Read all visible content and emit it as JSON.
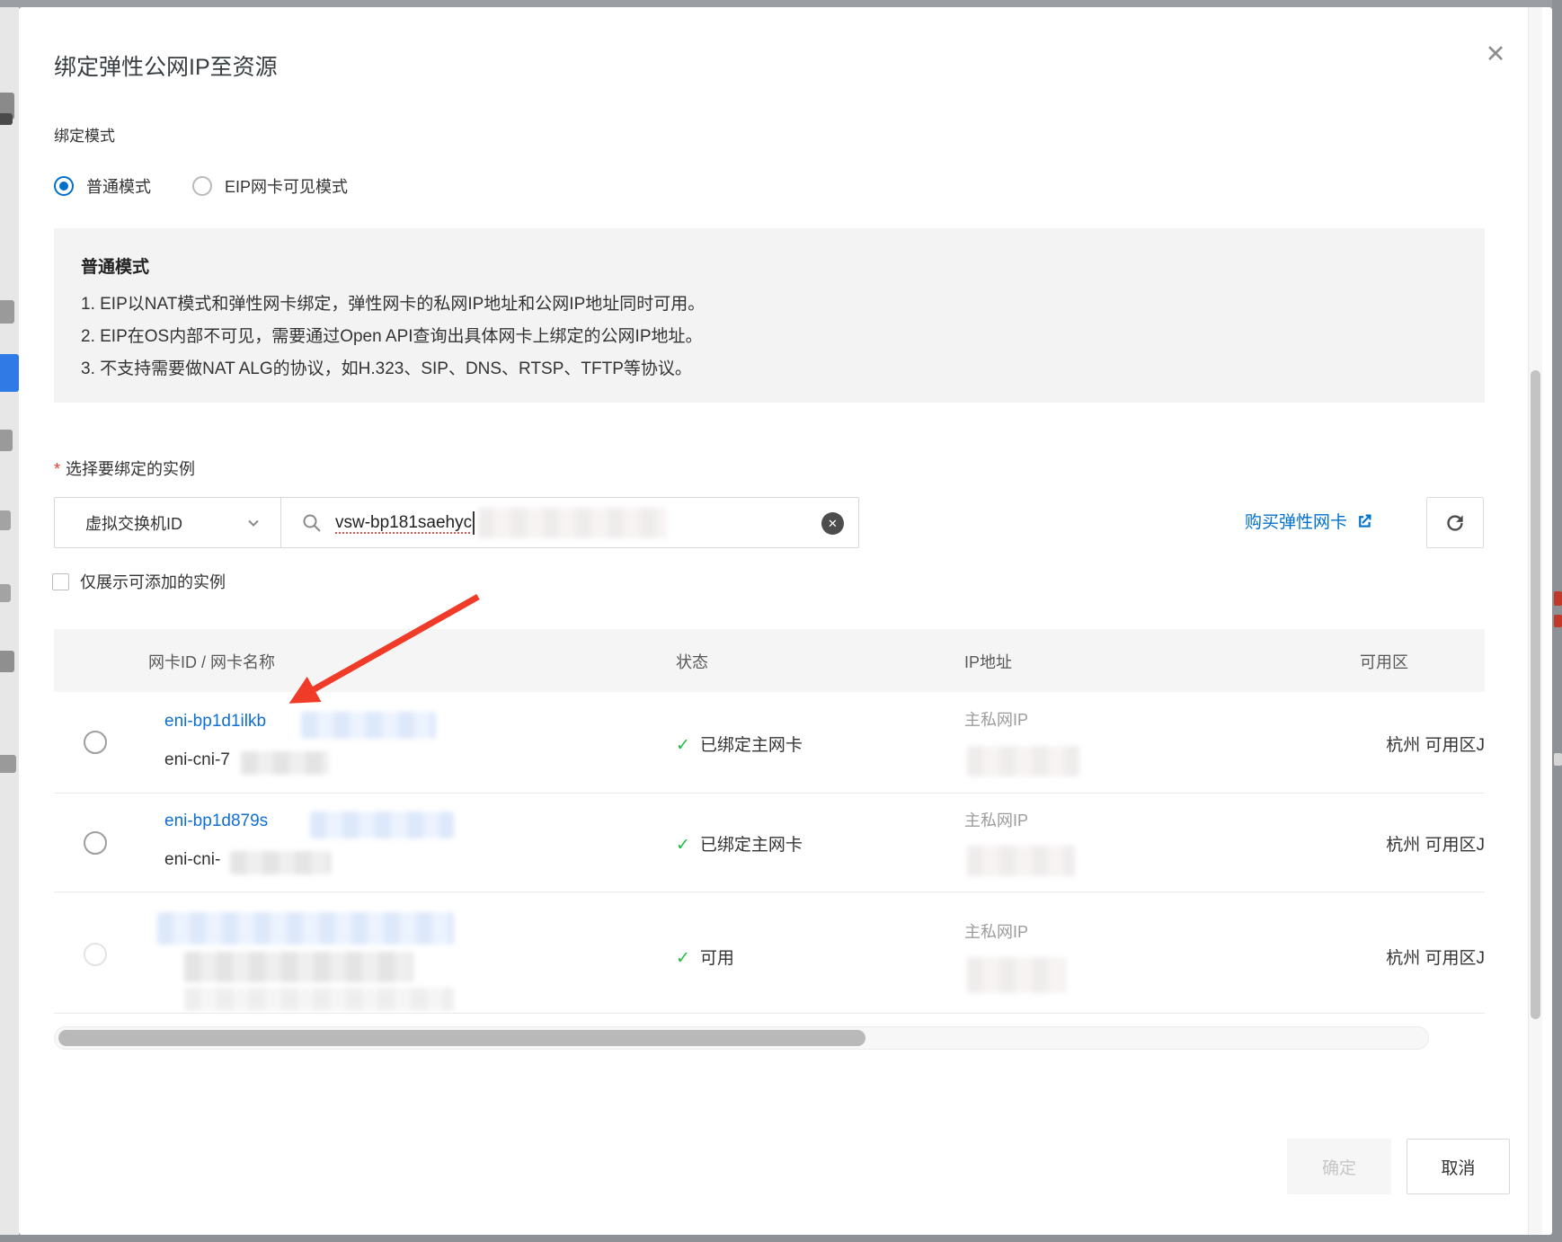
{
  "icons": {
    "close": "✕",
    "check": "✓",
    "clear": "✕"
  },
  "modal": {
    "title": "绑定弹性公网IP至资源",
    "binding_mode": {
      "label": "绑定模式",
      "options": [
        {
          "label": "普通模式",
          "selected": true
        },
        {
          "label": "EIP网卡可见模式",
          "selected": false
        }
      ]
    },
    "info_box": {
      "title": "普通模式",
      "lines": [
        "1. EIP以NAT模式和弹性网卡绑定，弹性网卡的私网IP地址和公网IP地址同时可用。",
        "2. EIP在OS内部不可见，需要通过Open API查询出具体网卡上绑定的公网IP地址。",
        "3. 不支持需要做NAT ALG的协议，如H.323、SIP、DNS、RTSP、TFTP等协议。"
      ]
    },
    "instance_picker": {
      "required_mark": "*",
      "label": "选择要绑定的实例",
      "filter_dropdown_value": "虚拟交换机ID",
      "search_value": "vsw-bp181saehyc",
      "buy_link_label": "购买弹性网卡",
      "show_addable_only_label": "仅展示可添加的实例"
    },
    "table": {
      "columns": [
        "网卡ID / 网卡名称",
        "状态",
        "IP地址",
        "可用区"
      ],
      "rows": [
        {
          "id": "eni-bp1d1ilkb",
          "name": "eni-cni-7",
          "status": "已绑定主网卡",
          "ip_label": "主私网IP",
          "zone": "杭州 可用区J"
        },
        {
          "id": "eni-bp1d879s",
          "name": "eni-cni-",
          "status": "已绑定主网卡",
          "ip_label": "主私网IP",
          "zone": "杭州 可用区J"
        },
        {
          "id": "",
          "name": "",
          "status": "可用",
          "ip_label": "主私网IP",
          "zone": "杭州 可用区J"
        }
      ]
    },
    "footer": {
      "confirm_label": "确定",
      "cancel_label": "取消"
    },
    "colors": {
      "accent_blue": "#0070cc",
      "success_green": "#1dbf3f",
      "danger_red": "#f0362b"
    }
  }
}
